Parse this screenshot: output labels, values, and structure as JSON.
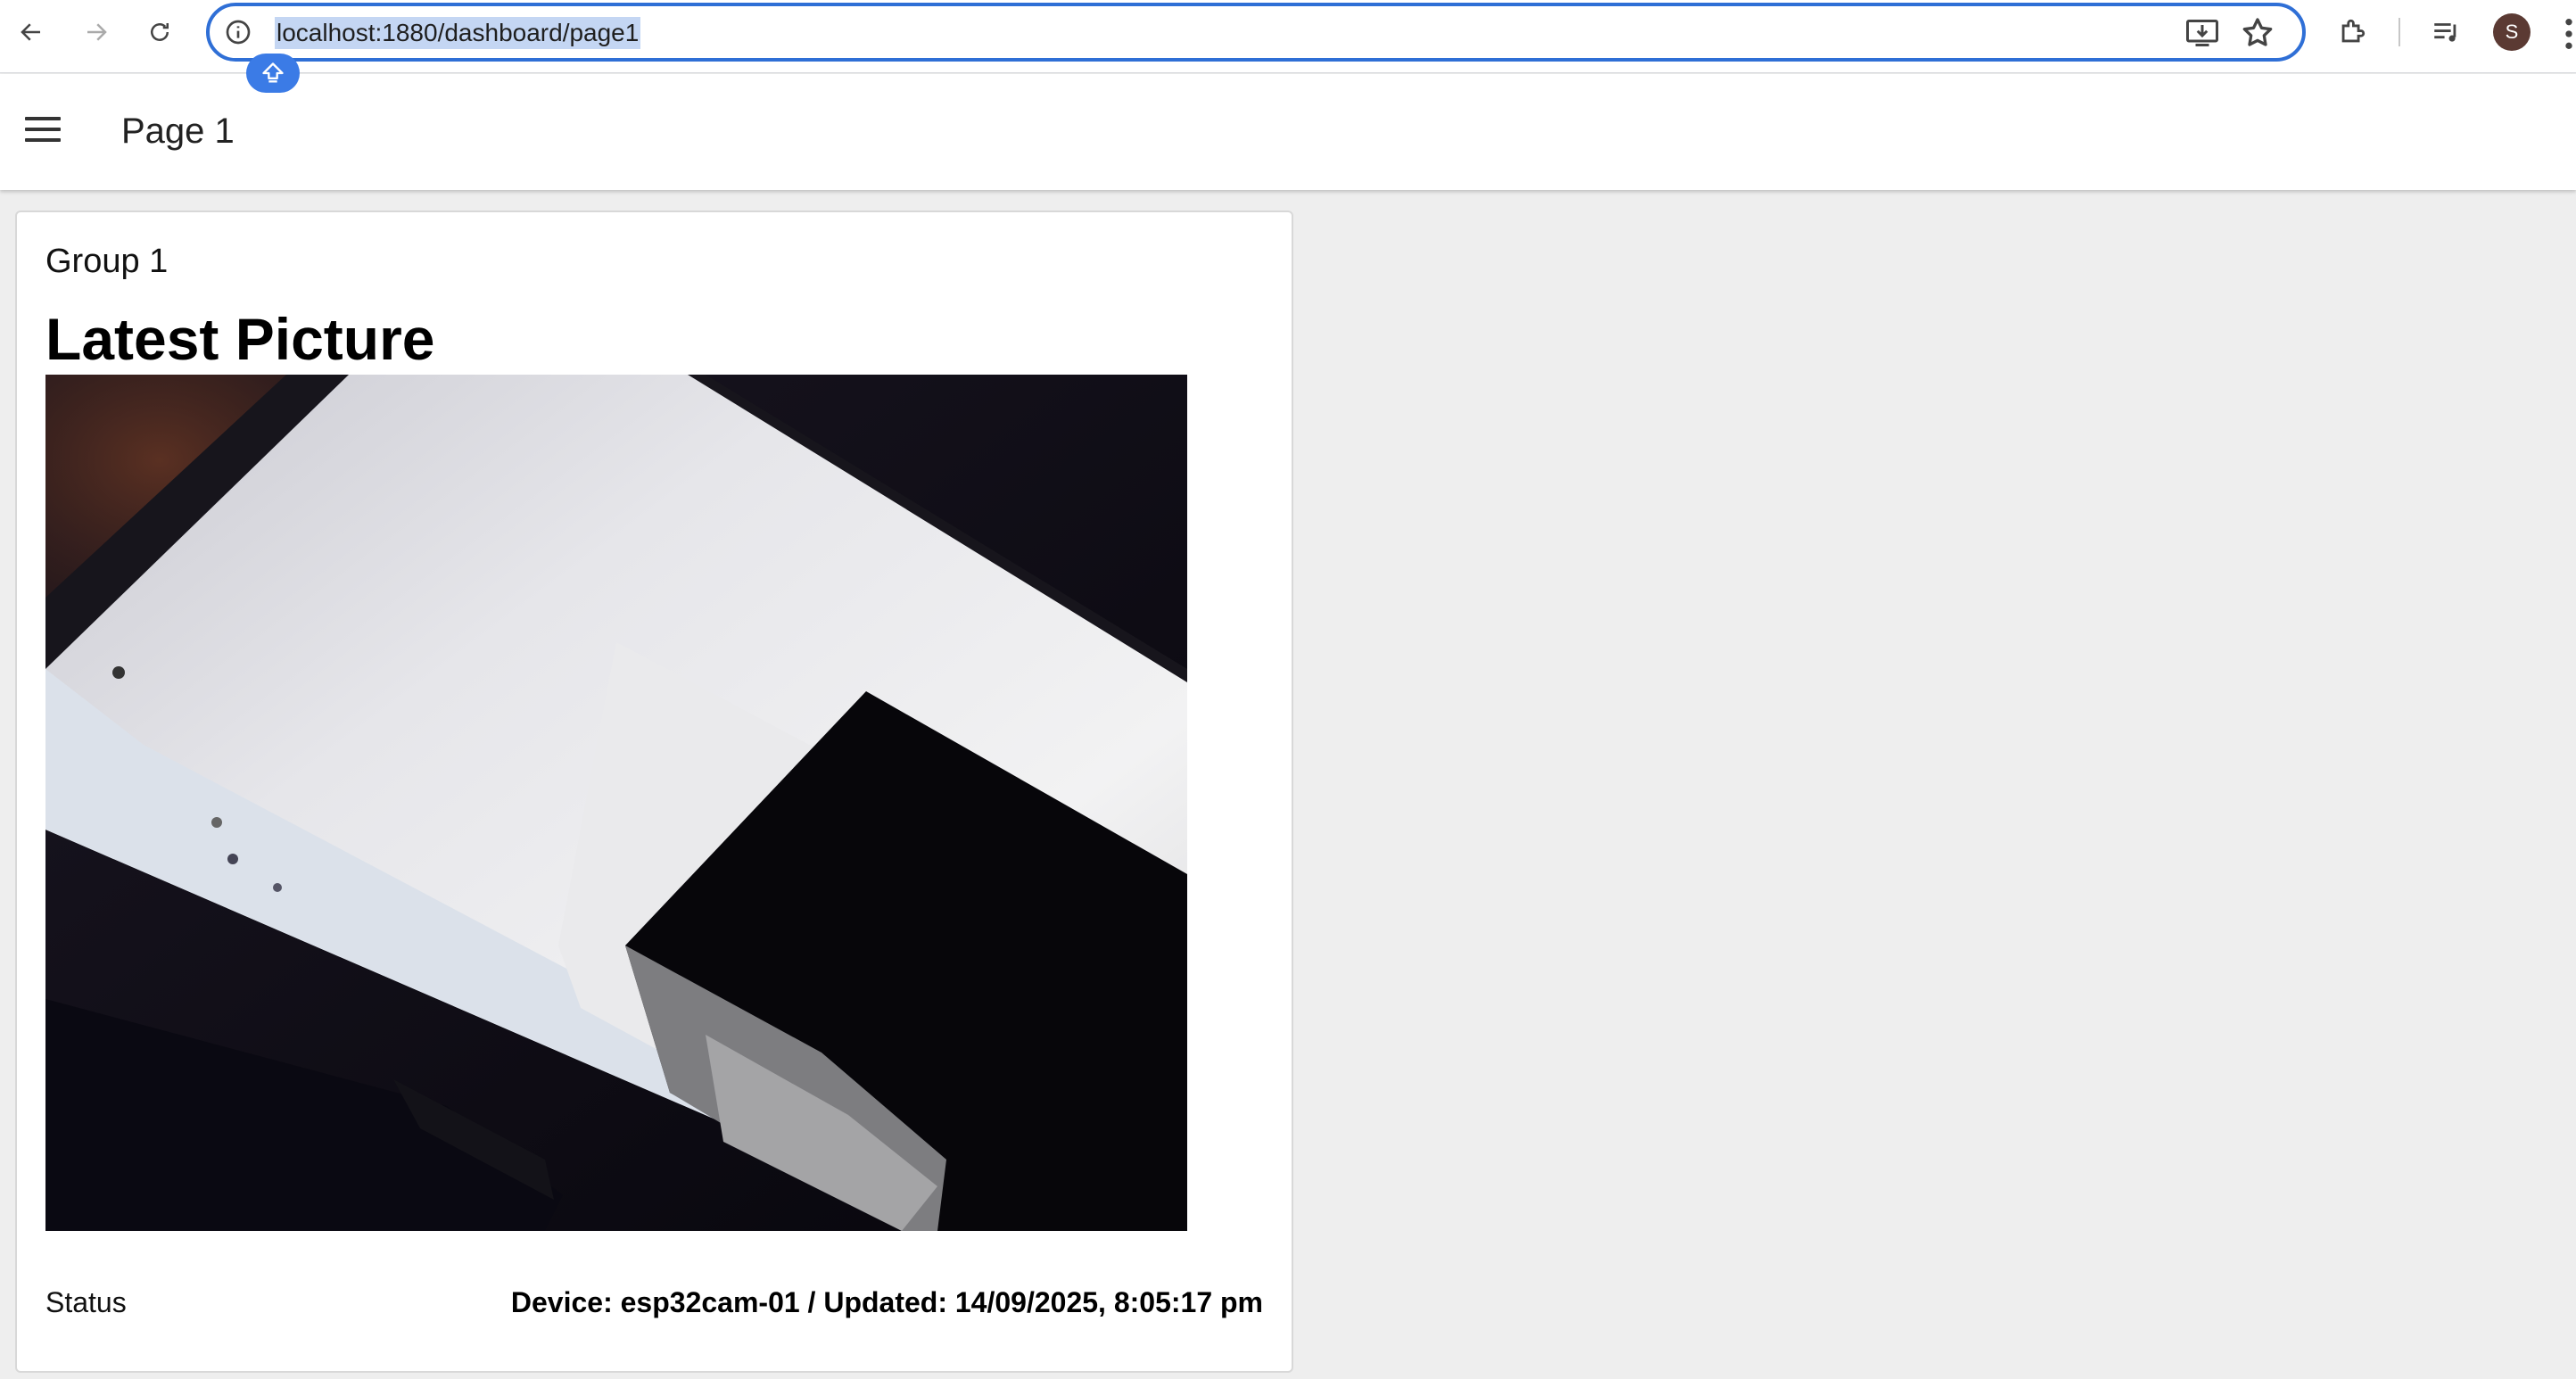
{
  "browser": {
    "url": "localhost:1880/dashboard/page1",
    "profile_initial": "S",
    "accent_color": "#2f6fd6"
  },
  "header": {
    "menu_icon": "hamburger-icon",
    "title": "Page 1"
  },
  "group": {
    "title": "Group 1",
    "heading": "Latest Picture",
    "image_icon": "camera-photo-image",
    "status_label": "Status",
    "status_value": "Device: esp32cam-01 / Updated: 14/09/2025, 8:05:17 pm"
  }
}
